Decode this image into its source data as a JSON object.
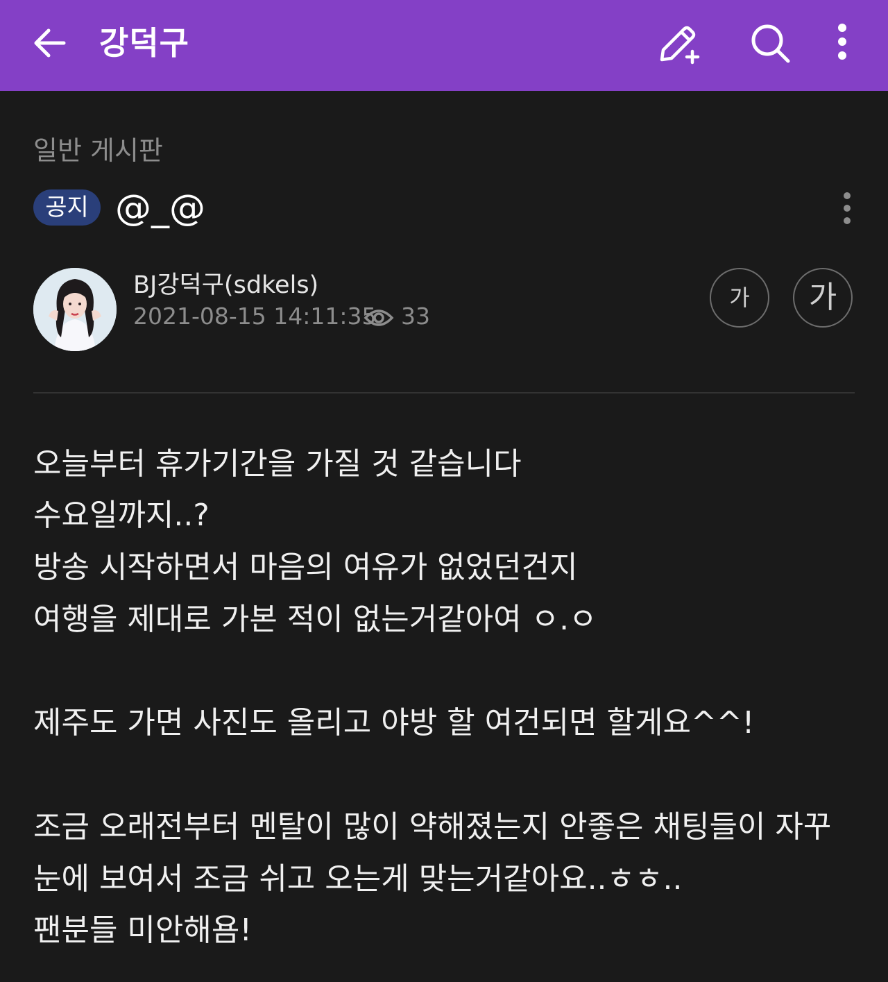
{
  "header": {
    "title": "강덕구",
    "back_icon": "arrow-left-icon",
    "write_icon": "pencil-plus-icon",
    "search_icon": "search-icon",
    "more_icon": "more-vertical-icon",
    "background_color": "#8440c6"
  },
  "board": {
    "name": "일반 게시판"
  },
  "post": {
    "badge": "공지",
    "title": "@_@",
    "author": "BJ강덕구(sdkels)",
    "date": "2021-08-15 14:11:35",
    "views": "33",
    "font_small_label": "가",
    "font_large_label": "가",
    "body": [
      "오늘부터 휴가기간을 가질 것 같습니다",
      "수요일까지..?",
      "방송 시작하면서 마음의 여유가 없었던건지",
      "여행을 제대로 가본 적이 없는거같아여 ㅇ.ㅇ",
      "",
      "제주도 가면 사진도 올리고 야방 할 여건되면 할게요^^!",
      "",
      "조금 오래전부터 멘탈이 많이 약해졌는지 안좋은 채팅들이 자꾸",
      "눈에 보여서 조금 쉬고 오는게 맞는거같아요..ㅎㅎ..",
      "팬분들 미안해욤!"
    ]
  }
}
